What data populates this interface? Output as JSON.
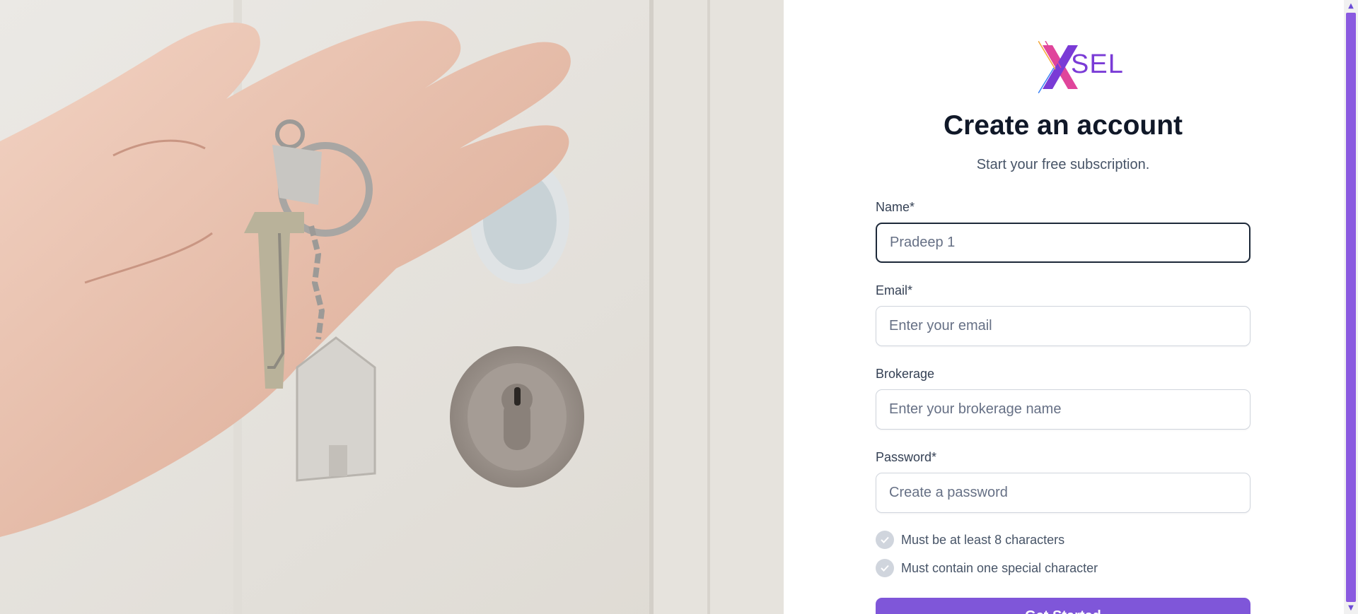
{
  "brand": {
    "logo_text": "SEL",
    "colors": {
      "primary": "#7f56d9",
      "logo_pink": "#e0459b",
      "logo_purple": "#7a3bd6"
    }
  },
  "header": {
    "title": "Create an account",
    "subtitle": "Start your free subscription."
  },
  "form": {
    "name": {
      "label": "Name*",
      "value": "",
      "placeholder": "Pradeep 1"
    },
    "email": {
      "label": "Email*",
      "value": "",
      "placeholder": "Enter your email"
    },
    "brokerage": {
      "label": "Brokerage",
      "value": "",
      "placeholder": "Enter your brokerage name"
    },
    "password": {
      "label": "Password*",
      "value": "",
      "placeholder": "Create a password"
    },
    "rules": [
      {
        "text": "Must be at least 8 characters",
        "icon": "check-icon",
        "met": false
      },
      {
        "text": "Must contain one special character",
        "icon": "check-icon",
        "met": false
      }
    ],
    "submit_label": "Get Started"
  },
  "hero_image": {
    "subject": "hand-holding-keys",
    "icon": "house-keychain-icon"
  }
}
